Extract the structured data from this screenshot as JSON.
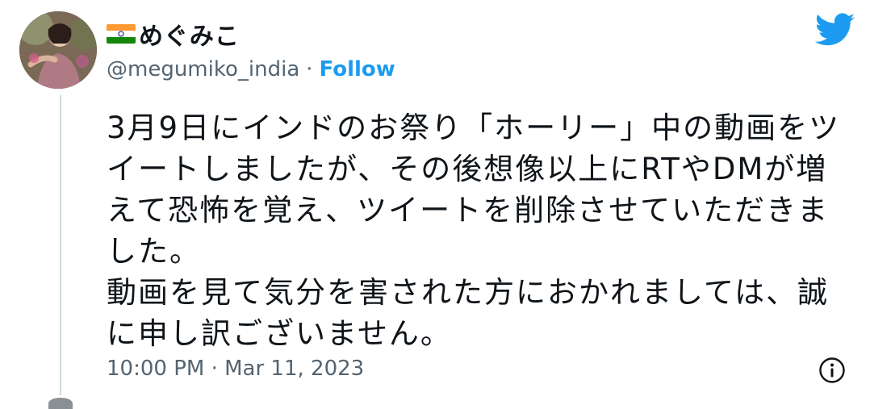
{
  "tweet": {
    "user": {
      "flag": "india-flag-emoji",
      "display_name": "めぐみこ",
      "handle": "@megumiko_india",
      "separator": "·",
      "follow_label": "Follow"
    },
    "text_lines": [
      "3月9日にインドのお祭り「ホーリー」中の動画をツ",
      "イートしましたが、その後想像以上にRTやDMが増",
      "えて恐怖を覚え、ツイートを削除させていただきま",
      "した。",
      "動画を見て気分を害された方におかれましては、誠",
      "に申し訳ございません。"
    ],
    "timestamp": "10:00 PM · Mar 11, 2023",
    "icons": {
      "brand": "twitter-bird-icon",
      "info": "info-icon"
    },
    "colors": {
      "accent": "#1d9bf0",
      "text": "#0f1419",
      "secondary": "#536471",
      "thread_line": "#cfd9de"
    }
  }
}
